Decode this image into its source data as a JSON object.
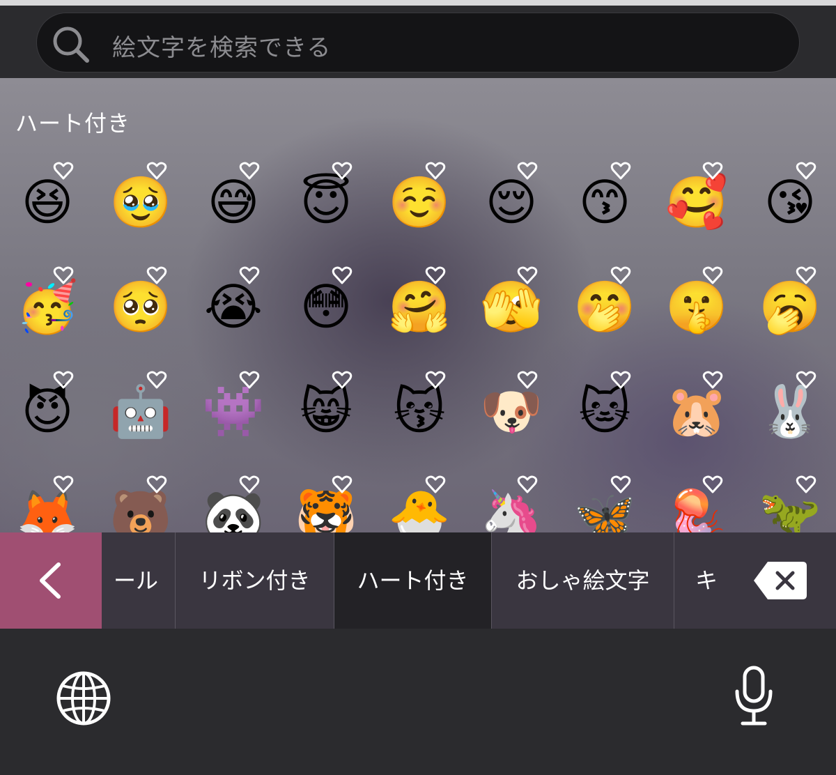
{
  "search": {
    "placeholder": "絵文字を検索できる",
    "icon": "search-icon"
  },
  "section": {
    "title": "ハート付き",
    "accent_color": "#ffffff"
  },
  "emoji_rows": [
    [
      "😆",
      "🥹",
      "😅",
      "😇",
      "☺️",
      "😌",
      "😙",
      "🥰",
      "😘"
    ],
    [
      "🥳",
      "🥺",
      "😭",
      "😳",
      "🤗",
      "🫣",
      "🤭",
      "🤫",
      "🥱"
    ],
    [
      "😈",
      "🤖",
      "👾",
      "😸",
      "😽",
      "🐶",
      "🐱",
      "🐹",
      "🐰"
    ],
    [
      "🦊",
      "🐻",
      "🐼",
      "🐯",
      "🐣",
      "🦄",
      "🦋",
      "🪼",
      "🦖"
    ]
  ],
  "categories": [
    {
      "label": "ール",
      "selected": false
    },
    {
      "label": "リボン付き",
      "selected": false
    },
    {
      "label": "ハート付き",
      "selected": true
    },
    {
      "label": "おしゃ絵文字",
      "selected": false
    },
    {
      "label": "キ",
      "selected": false
    }
  ],
  "colors": {
    "back_button": "#a04f72",
    "selected_tab": "#232226",
    "category_bar": "#3a3640"
  },
  "icons": {
    "back": "chevron-left-icon",
    "delete": "delete-backspace-icon",
    "globe": "globe-icon",
    "mic": "microphone-icon"
  }
}
